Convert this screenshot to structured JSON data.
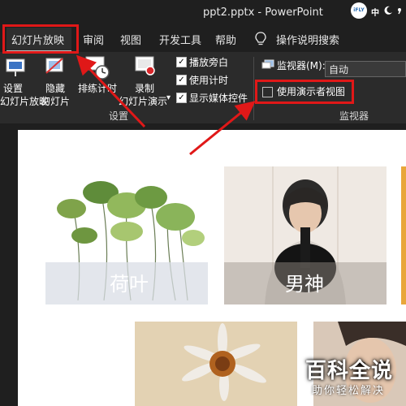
{
  "window": {
    "title": "ppt2.pptx  -  PowerPoint"
  },
  "titlebar": {
    "ifly_label": "iFLY",
    "lang_label": "中",
    "icons": [
      "moon-icon",
      "comma-icon",
      "keyboard-icon"
    ]
  },
  "menu": {
    "tabs": [
      {
        "label": "幻灯片放映",
        "active": true
      },
      {
        "label": "审阅"
      },
      {
        "label": "视图"
      },
      {
        "label": "开发工具"
      },
      {
        "label": "帮助"
      }
    ],
    "search_label": "操作说明搜索"
  },
  "ribbon": {
    "setup_group": {
      "buttons": [
        {
          "line1": "设置",
          "line2": "幻灯片放映",
          "icon": "setup-slideshow-icon"
        },
        {
          "line1": "隐藏",
          "line2": "幻灯片",
          "icon": "hide-slide-icon"
        },
        {
          "line1": "排练计时",
          "line2": "",
          "icon": "rehearse-timings-icon"
        },
        {
          "line1": "录制",
          "line2": "幻灯片演示",
          "icon": "record-slideshow-icon"
        }
      ],
      "checkboxes": [
        {
          "label": "播放旁白",
          "checked": true
        },
        {
          "label": "使用计时",
          "checked": true
        },
        {
          "label": "显示媒体控件",
          "checked": true
        }
      ],
      "group_label": "设置"
    },
    "monitors_group": {
      "monitor_label": "监视器(M):",
      "monitor_value": "自动",
      "presenter_view_label": "使用演示者视图",
      "presenter_view_checked": false,
      "group_label": "监视器"
    }
  },
  "slide": {
    "photos": [
      {
        "caption": "荷叶"
      },
      {
        "caption": "男神"
      }
    ]
  },
  "watermark": {
    "line1": "百科全说",
    "line2": "助你轻松解决"
  },
  "colors": {
    "highlight_red": "#e01818",
    "ribbon_bg": "#2b2b2b",
    "window_bg": "#1f1f1f"
  }
}
